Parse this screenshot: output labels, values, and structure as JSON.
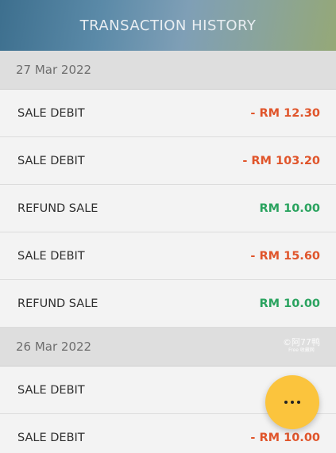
{
  "header": {
    "title": "TRANSACTION HISTORY"
  },
  "groups": [
    {
      "date": "27 Mar 2022",
      "transactions": [
        {
          "type": "SALE DEBIT",
          "amount": "- RM 12.30",
          "kind": "debit"
        },
        {
          "type": "SALE DEBIT",
          "amount": "- RM 103.20",
          "kind": "debit"
        },
        {
          "type": "REFUND SALE",
          "amount": "RM 10.00",
          "kind": "credit"
        },
        {
          "type": "SALE DEBIT",
          "amount": "- RM 15.60",
          "kind": "debit"
        },
        {
          "type": "REFUND SALE",
          "amount": "RM 10.00",
          "kind": "credit"
        }
      ]
    },
    {
      "date": "26 Mar 2022",
      "transactions": [
        {
          "type": "SALE DEBIT",
          "amount": "",
          "kind": "debit"
        },
        {
          "type": "SALE DEBIT",
          "amount": "- RM 10.00",
          "kind": "debit"
        }
      ]
    }
  ],
  "watermark": {
    "main": "©阿77鸭",
    "sub": "Free 收藏网"
  },
  "fab": {
    "icon": "more-horizontal-icon"
  },
  "colors": {
    "debit": "#e0552b",
    "credit": "#2aa35f",
    "fab": "#fbc43d",
    "date_bar": "#dedede"
  }
}
